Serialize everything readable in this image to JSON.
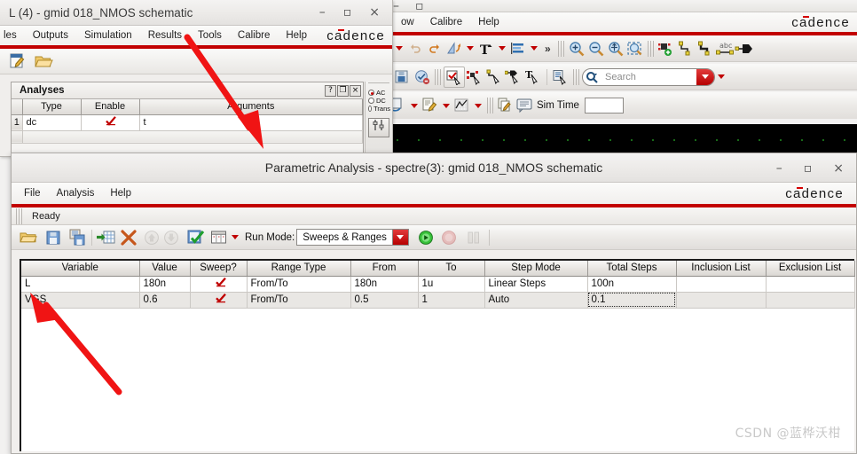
{
  "schematic_window": {
    "title": "L (4) - gmid 018_NMOS schematic",
    "window_buttons": {
      "minimize": "–",
      "maximize": "▫",
      "close": "×"
    },
    "menu": [
      "les",
      "Outputs",
      "Simulation",
      "Results",
      "Tools",
      "Calibre",
      "Help"
    ],
    "brand": "cadence",
    "analyses_panel": {
      "title": "Analyses",
      "panel_buttons": [
        "?",
        "❐",
        "×"
      ],
      "columns": [
        "Type",
        "Enable",
        "Arguments"
      ],
      "rows": [
        {
          "num": "1",
          "type": "dc",
          "enable": true,
          "arguments": "t"
        }
      ]
    },
    "mini_dock": {
      "radios": [
        {
          "label": "AC",
          "selected": true
        },
        {
          "label": "DC",
          "selected": false
        },
        {
          "label": "Trans",
          "selected": false
        }
      ],
      "button_icon": "sliders-icon"
    },
    "toolbar_icons": [
      "new-cellview-icon",
      "open-icon"
    ]
  },
  "background_window": {
    "menu": [
      "ow",
      "Calibre",
      "Help"
    ],
    "brand": "cadence",
    "window_buttons": {
      "minimize": "–",
      "maximize": "▫"
    },
    "toolbar_row1": [
      "undo-icon",
      "redo-icon",
      "flip-icon",
      "text-icon",
      "align-icon",
      "chevrons-right-icon",
      "zoom-in-icon",
      "zoom-out-icon",
      "zoom-fit-icon",
      "zoom-area-icon",
      "add-instance-icon",
      "add-wire-icon",
      "add-wire-name-icon",
      "add-label-icon",
      "add-pin-icon"
    ],
    "toolbar_row2": [
      "save-icon",
      "check-save-icon",
      "select-check-icon",
      "select-net-icon",
      "select-wire-icon",
      "select-pin-icon",
      "select-text-icon",
      "properties-icon"
    ],
    "search": {
      "placeholder": "Search",
      "icon": "search-icon"
    },
    "sim_time": {
      "label": "Sim Time",
      "value": ""
    }
  },
  "parametric_window": {
    "title": "Parametric Analysis - spectre(3): gmid 018_NMOS schematic",
    "window_buttons": {
      "minimize": "–",
      "maximize": "▫",
      "close": "×"
    },
    "menu": [
      "File",
      "Analysis",
      "Help"
    ],
    "brand": "cadence",
    "status": "Ready",
    "toolbar": {
      "icons": [
        "open-icon",
        "save-icon",
        "save-as-icon",
        "export-table-icon",
        "delete-icon",
        "move-up-icon",
        "move-down-icon",
        "select-all-icon",
        "table-view-icon"
      ],
      "run_mode_label": "Run Mode:",
      "run_mode_value": "Sweeps & Ranges",
      "run_mode_options": [
        "Sweeps & Ranges"
      ],
      "start_icon": "run-icon",
      "stop_icon": "stop-icon",
      "pause_icon": "pause-icon"
    },
    "table": {
      "columns": [
        "Variable",
        "Value",
        "Sweep?",
        "Range Type",
        "From",
        "To",
        "Step Mode",
        "Total Steps",
        "Inclusion List",
        "Exclusion List"
      ],
      "rows": [
        {
          "variable": "L",
          "value": "180n",
          "sweep": true,
          "range_type": "From/To",
          "from": "180n",
          "to": "1u",
          "step_mode": "Linear Steps",
          "total_steps": "100n",
          "inclusion_list": "",
          "exclusion_list": "",
          "focus": false
        },
        {
          "variable": "VGS",
          "value": "0.6",
          "sweep": true,
          "range_type": "From/To",
          "from": "0.5",
          "to": "1",
          "step_mode": "Auto",
          "total_steps": "0.1",
          "inclusion_list": "",
          "exclusion_list": "",
          "focus": true
        }
      ]
    }
  },
  "annotations": {
    "arrow_top": {
      "color": "#f01414",
      "points_to": "analyses-arguments-cell"
    },
    "arrow_bottom": {
      "color": "#f01414",
      "points_to": "vgs-variable-cell"
    }
  },
  "watermark": {
    "text": "CSDN @蓝桦沃柑",
    "color": "#c9c9c9"
  },
  "theme": {
    "accent_red": "#c20000",
    "cadence_red": "#d40000",
    "window_bg": "#f1efed"
  }
}
